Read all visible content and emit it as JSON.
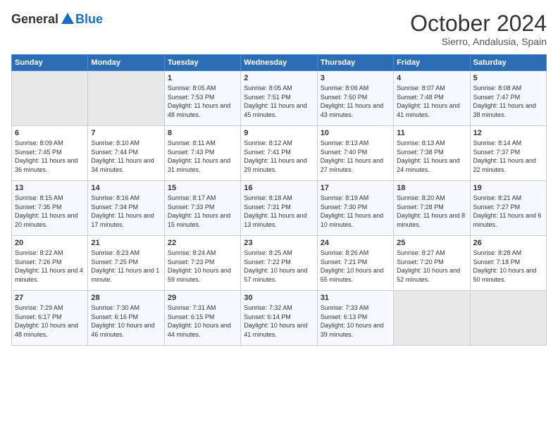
{
  "logo": {
    "general": "General",
    "blue": "Blue"
  },
  "header": {
    "month": "October 2024",
    "location": "Sierro, Andalusia, Spain"
  },
  "weekdays": [
    "Sunday",
    "Monday",
    "Tuesday",
    "Wednesday",
    "Thursday",
    "Friday",
    "Saturday"
  ],
  "weeks": [
    [
      {
        "day": "",
        "info": ""
      },
      {
        "day": "",
        "info": ""
      },
      {
        "day": "1",
        "info": "Sunrise: 8:05 AM\nSunset: 7:53 PM\nDaylight: 11 hours and 48 minutes."
      },
      {
        "day": "2",
        "info": "Sunrise: 8:05 AM\nSunset: 7:51 PM\nDaylight: 11 hours and 45 minutes."
      },
      {
        "day": "3",
        "info": "Sunrise: 8:06 AM\nSunset: 7:50 PM\nDaylight: 11 hours and 43 minutes."
      },
      {
        "day": "4",
        "info": "Sunrise: 8:07 AM\nSunset: 7:48 PM\nDaylight: 11 hours and 41 minutes."
      },
      {
        "day": "5",
        "info": "Sunrise: 8:08 AM\nSunset: 7:47 PM\nDaylight: 11 hours and 38 minutes."
      }
    ],
    [
      {
        "day": "6",
        "info": "Sunrise: 8:09 AM\nSunset: 7:45 PM\nDaylight: 11 hours and 36 minutes."
      },
      {
        "day": "7",
        "info": "Sunrise: 8:10 AM\nSunset: 7:44 PM\nDaylight: 11 hours and 34 minutes."
      },
      {
        "day": "8",
        "info": "Sunrise: 8:11 AM\nSunset: 7:43 PM\nDaylight: 11 hours and 31 minutes."
      },
      {
        "day": "9",
        "info": "Sunrise: 8:12 AM\nSunset: 7:41 PM\nDaylight: 11 hours and 29 minutes."
      },
      {
        "day": "10",
        "info": "Sunrise: 8:13 AM\nSunset: 7:40 PM\nDaylight: 11 hours and 27 minutes."
      },
      {
        "day": "11",
        "info": "Sunrise: 8:13 AM\nSunset: 7:38 PM\nDaylight: 11 hours and 24 minutes."
      },
      {
        "day": "12",
        "info": "Sunrise: 8:14 AM\nSunset: 7:37 PM\nDaylight: 11 hours and 22 minutes."
      }
    ],
    [
      {
        "day": "13",
        "info": "Sunrise: 8:15 AM\nSunset: 7:35 PM\nDaylight: 11 hours and 20 minutes."
      },
      {
        "day": "14",
        "info": "Sunrise: 8:16 AM\nSunset: 7:34 PM\nDaylight: 11 hours and 17 minutes."
      },
      {
        "day": "15",
        "info": "Sunrise: 8:17 AM\nSunset: 7:33 PM\nDaylight: 11 hours and 15 minutes."
      },
      {
        "day": "16",
        "info": "Sunrise: 8:18 AM\nSunset: 7:31 PM\nDaylight: 11 hours and 13 minutes."
      },
      {
        "day": "17",
        "info": "Sunrise: 8:19 AM\nSunset: 7:30 PM\nDaylight: 11 hours and 10 minutes."
      },
      {
        "day": "18",
        "info": "Sunrise: 8:20 AM\nSunset: 7:28 PM\nDaylight: 11 hours and 8 minutes."
      },
      {
        "day": "19",
        "info": "Sunrise: 8:21 AM\nSunset: 7:27 PM\nDaylight: 11 hours and 6 minutes."
      }
    ],
    [
      {
        "day": "20",
        "info": "Sunrise: 8:22 AM\nSunset: 7:26 PM\nDaylight: 11 hours and 4 minutes."
      },
      {
        "day": "21",
        "info": "Sunrise: 8:23 AM\nSunset: 7:25 PM\nDaylight: 11 hours and 1 minute."
      },
      {
        "day": "22",
        "info": "Sunrise: 8:24 AM\nSunset: 7:23 PM\nDaylight: 10 hours and 59 minutes."
      },
      {
        "day": "23",
        "info": "Sunrise: 8:25 AM\nSunset: 7:22 PM\nDaylight: 10 hours and 57 minutes."
      },
      {
        "day": "24",
        "info": "Sunrise: 8:26 AM\nSunset: 7:21 PM\nDaylight: 10 hours and 55 minutes."
      },
      {
        "day": "25",
        "info": "Sunrise: 8:27 AM\nSunset: 7:20 PM\nDaylight: 10 hours and 52 minutes."
      },
      {
        "day": "26",
        "info": "Sunrise: 8:28 AM\nSunset: 7:18 PM\nDaylight: 10 hours and 50 minutes."
      }
    ],
    [
      {
        "day": "27",
        "info": "Sunrise: 7:29 AM\nSunset: 6:17 PM\nDaylight: 10 hours and 48 minutes."
      },
      {
        "day": "28",
        "info": "Sunrise: 7:30 AM\nSunset: 6:16 PM\nDaylight: 10 hours and 46 minutes."
      },
      {
        "day": "29",
        "info": "Sunrise: 7:31 AM\nSunset: 6:15 PM\nDaylight: 10 hours and 44 minutes."
      },
      {
        "day": "30",
        "info": "Sunrise: 7:32 AM\nSunset: 6:14 PM\nDaylight: 10 hours and 41 minutes."
      },
      {
        "day": "31",
        "info": "Sunrise: 7:33 AM\nSunset: 6:13 PM\nDaylight: 10 hours and 39 minutes."
      },
      {
        "day": "",
        "info": ""
      },
      {
        "day": "",
        "info": ""
      }
    ]
  ]
}
